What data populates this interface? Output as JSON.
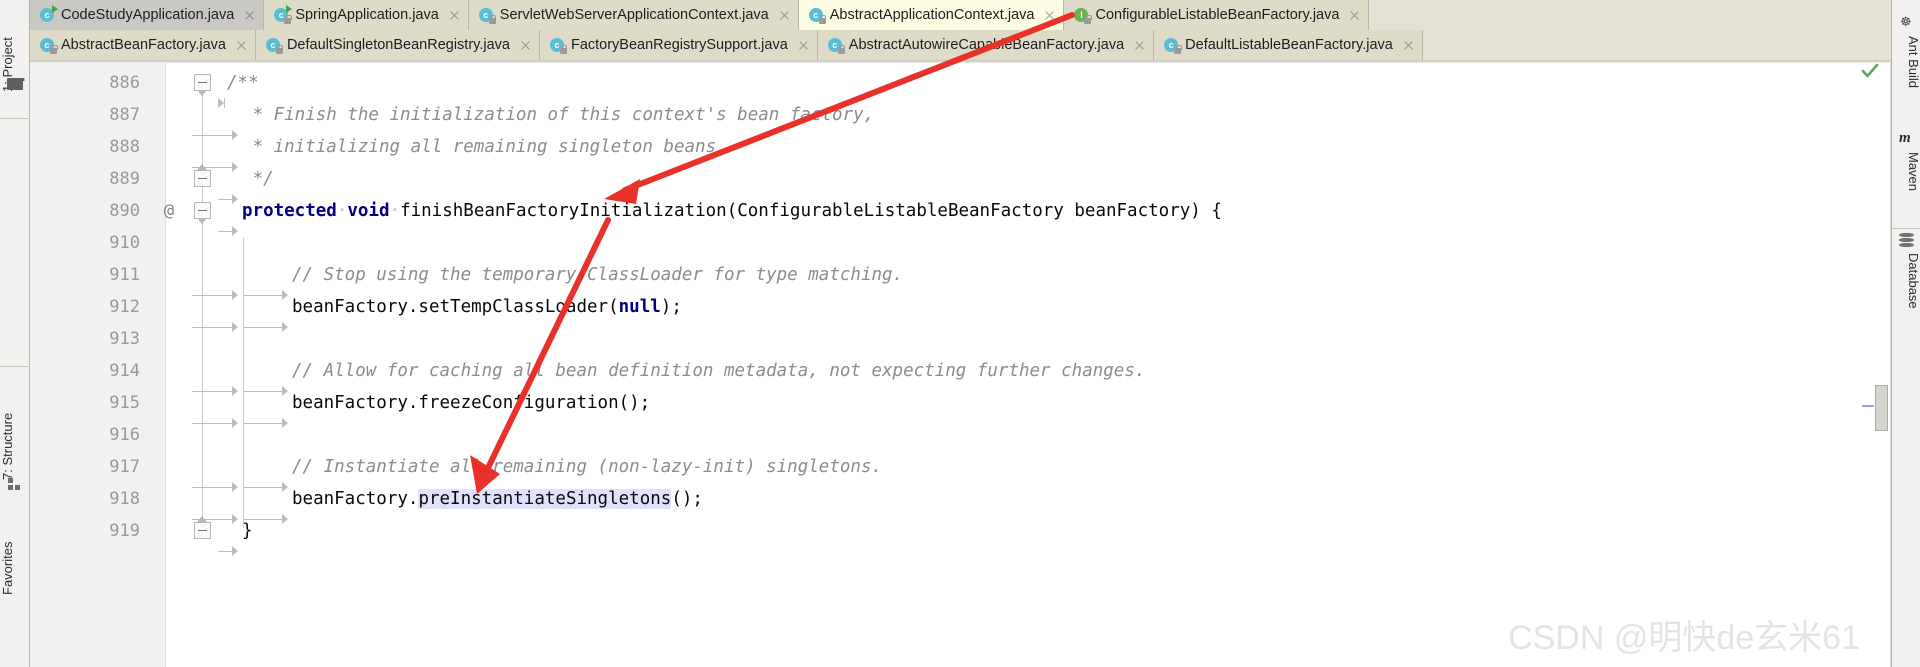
{
  "window": {
    "editor_background": "#ffffff",
    "tab_background": "#e3e2d4",
    "active_tab_background": "#fcfce2",
    "highlight_color": "#e2e1fb",
    "keyword_color": "#000080",
    "comment_color": "#8c8c8c",
    "arrow_color": "#e8312a"
  },
  "left_toolbar": {
    "items": [
      {
        "label": "1: Project",
        "icon": "project-icon"
      },
      {
        "label": "7: Structure",
        "icon": "structure-icon"
      },
      {
        "label": "Favorites",
        "icon": "favorites-icon"
      }
    ],
    "folder_icon": "folder-icon"
  },
  "right_toolbar": {
    "items": [
      {
        "label": "Ant Build",
        "icon": "ant-icon",
        "glyph": "☸"
      },
      {
        "label": "Maven",
        "icon": "maven-icon",
        "glyph": "m"
      },
      {
        "label": "Database",
        "icon": "database-icon",
        "glyph": "database"
      }
    ]
  },
  "tabs": {
    "row1": [
      {
        "label": "CodeStudyApplication.java",
        "icon": "class-run-icon",
        "letter": "c",
        "state": "selected-inactive",
        "closable": true
      },
      {
        "label": "SpringApplication.java",
        "icon": "class-run-icon",
        "letter": "c",
        "state": "normal",
        "closable": true
      },
      {
        "label": "ServletWebServerApplicationContext.java",
        "icon": "class-icon",
        "letter": "c",
        "state": "normal",
        "closable": true
      },
      {
        "label": "AbstractApplicationContext.java",
        "icon": "class-icon",
        "letter": "c",
        "state": "active",
        "closable": true
      },
      {
        "label": "ConfigurableListableBeanFactory.java",
        "icon": "interface-icon",
        "letter": "I",
        "state": "normal",
        "closable": true
      }
    ],
    "row2": [
      {
        "label": "AbstractBeanFactory.java",
        "icon": "class-icon",
        "letter": "c",
        "state": "normal",
        "closable": true
      },
      {
        "label": "DefaultSingletonBeanRegistry.java",
        "icon": "class-icon",
        "letter": "c",
        "state": "normal",
        "closable": true
      },
      {
        "label": "FactoryBeanRegistrySupport.java",
        "icon": "class-icon",
        "letter": "c",
        "state": "normal",
        "closable": true
      },
      {
        "label": "AbstractAutowireCapableBeanFactory.java",
        "icon": "class-icon",
        "letter": "c",
        "state": "normal",
        "closable": true
      },
      {
        "label": "DefaultListableBeanFactory.java",
        "icon": "class-icon",
        "letter": "c",
        "state": "normal",
        "closable": true
      }
    ]
  },
  "editor": {
    "status_icon": "inspection-ok-check",
    "lines": [
      {
        "number": "886",
        "gutter_mark": "",
        "fold": "top",
        "indent": 1,
        "text": "/**",
        "type": "comment"
      },
      {
        "number": "887",
        "gutter_mark": "",
        "fold": "",
        "indent": 1,
        "text": " * Finish the initialization of this context's bean factory,",
        "type": "comment"
      },
      {
        "number": "888",
        "gutter_mark": "",
        "fold": "",
        "indent": 1,
        "text": " * initializing all remaining singleton beans.",
        "type": "comment"
      },
      {
        "number": "889",
        "gutter_mark": "",
        "fold": "bot",
        "indent": 1,
        "text": " */",
        "type": "comment"
      },
      {
        "number": "890",
        "gutter_mark": "@",
        "fold": "top",
        "indent": 1,
        "text": "protected void finishBeanFactoryInitialization(ConfigurableListableBeanFactory beanFactory) {",
        "type": "signature"
      },
      {
        "number": "910",
        "gutter_mark": "",
        "fold": "",
        "indent": 0,
        "text": "",
        "type": "blank"
      },
      {
        "number": "911",
        "gutter_mark": "",
        "fold": "",
        "indent": 2,
        "text": "// Stop using the temporary ClassLoader for type matching.",
        "type": "comment"
      },
      {
        "number": "912",
        "gutter_mark": "",
        "fold": "",
        "indent": 2,
        "text": "beanFactory.setTempClassLoader(null);",
        "type": "code"
      },
      {
        "number": "913",
        "gutter_mark": "",
        "fold": "",
        "indent": 0,
        "text": "",
        "type": "blank"
      },
      {
        "number": "914",
        "gutter_mark": "",
        "fold": "",
        "indent": 2,
        "text": "// Allow for caching all bean definition metadata, not expecting further changes.",
        "type": "comment"
      },
      {
        "number": "915",
        "gutter_mark": "",
        "fold": "",
        "indent": 2,
        "text": "beanFactory.freezeConfiguration();",
        "type": "code"
      },
      {
        "number": "916",
        "gutter_mark": "",
        "fold": "",
        "indent": 0,
        "text": "",
        "type": "blank"
      },
      {
        "number": "917",
        "gutter_mark": "",
        "fold": "",
        "indent": 2,
        "text": "// Instantiate all remaining (non-lazy-init) singletons.",
        "type": "comment"
      },
      {
        "number": "918",
        "gutter_mark": "",
        "fold": "",
        "indent": 2,
        "text": "beanFactory.preInstantiateSingletons();",
        "type": "code",
        "selection": "preInstantiateSingletons"
      },
      {
        "number": "919",
        "gutter_mark": "",
        "fold": "bot",
        "indent": 1,
        "text": "}",
        "type": "code"
      }
    ],
    "code_tokens": {
      "line890_kw1": "protected",
      "line890_kw2": "void",
      "line890_name": "finishBeanFactoryInitialization(ConfigurableListableBeanFactory beanFactory) {",
      "line912_pre": "beanFactory.setTempClassLoader(",
      "line912_null": "null",
      "line912_post": ");",
      "line915_text": "beanFactory.freezeConfiguration();",
      "line918_pre": "beanFactory.",
      "line918_sel": "preInstantiateSingletons",
      "line918_post": "();",
      "line919_text": "}",
      "line886_text": "/**",
      "line887_text": " * Finish the initialization of this context's bean factory,",
      "line888_text": " * initializing all remaining singleton beans.",
      "line889_text": " */",
      "line911_text": "// Stop using the temporary ClassLoader for type matching.",
      "line914_text": "// Allow for caching all bean definition metadata, not expecting further changes.",
      "line917_text": "// Instantiate all remaining (non-lazy-init) singletons."
    }
  },
  "watermark": {
    "text": "CSDN @明快de玄米61"
  }
}
